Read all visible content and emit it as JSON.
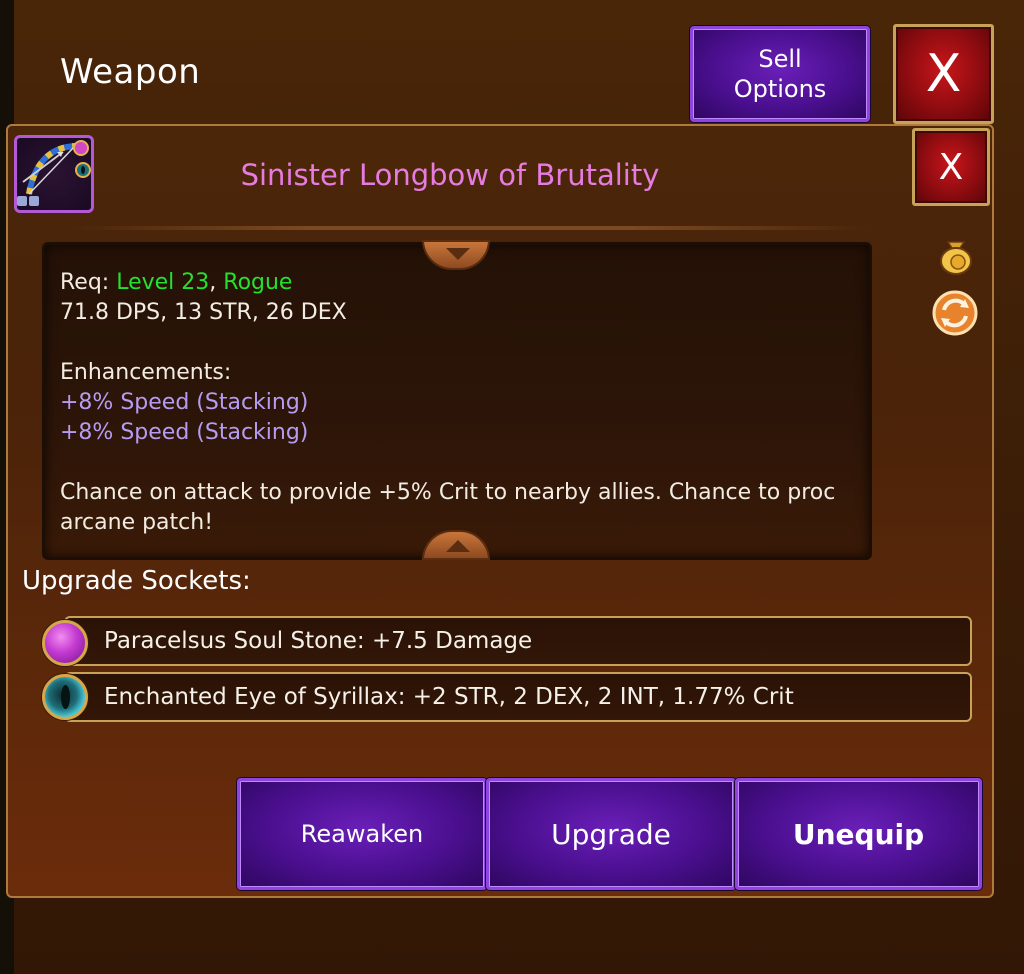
{
  "header": {
    "title": "Weapon",
    "sell_label": "Sell Options",
    "close_label": "X"
  },
  "item": {
    "name": "Sinister Longbow of Brutality",
    "close_label": "X",
    "name_color": "#e67be0",
    "req_prefix": "Req: ",
    "req_level": "Level 23",
    "req_sep": ", ",
    "req_class": "Rogue",
    "stats": "71.8 DPS, 13 STR, 26 DEX",
    "enhancements_title": "Enhancements:",
    "enhancements": [
      "+8% Speed (Stacking)",
      "+8% Speed (Stacking)"
    ],
    "proc_text": "Chance on attack to provide +5% Crit to nearby allies. Chance to proc arcane patch!"
  },
  "side_icons": [
    "money-bag-icon",
    "swap-icon"
  ],
  "sockets": {
    "title": "Upgrade Sockets:",
    "items": [
      {
        "icon": "purple-soul-stone-icon",
        "text": "Paracelsus Soul Stone: +7.5 Damage"
      },
      {
        "icon": "eye-gem-icon",
        "text": "Enchanted Eye of Syrillax: +2 STR, 2 DEX, 2 INT, 1.77% Crit"
      }
    ]
  },
  "actions": {
    "reawaken": "Reawaken",
    "upgrade": "Upgrade",
    "unequip": "Unequip"
  },
  "colors": {
    "button_purple": "#4a0f8f",
    "close_red": "#8e0c10",
    "requirement_green": "#25e02d",
    "enhancement_lavender": "#b69cf0"
  }
}
